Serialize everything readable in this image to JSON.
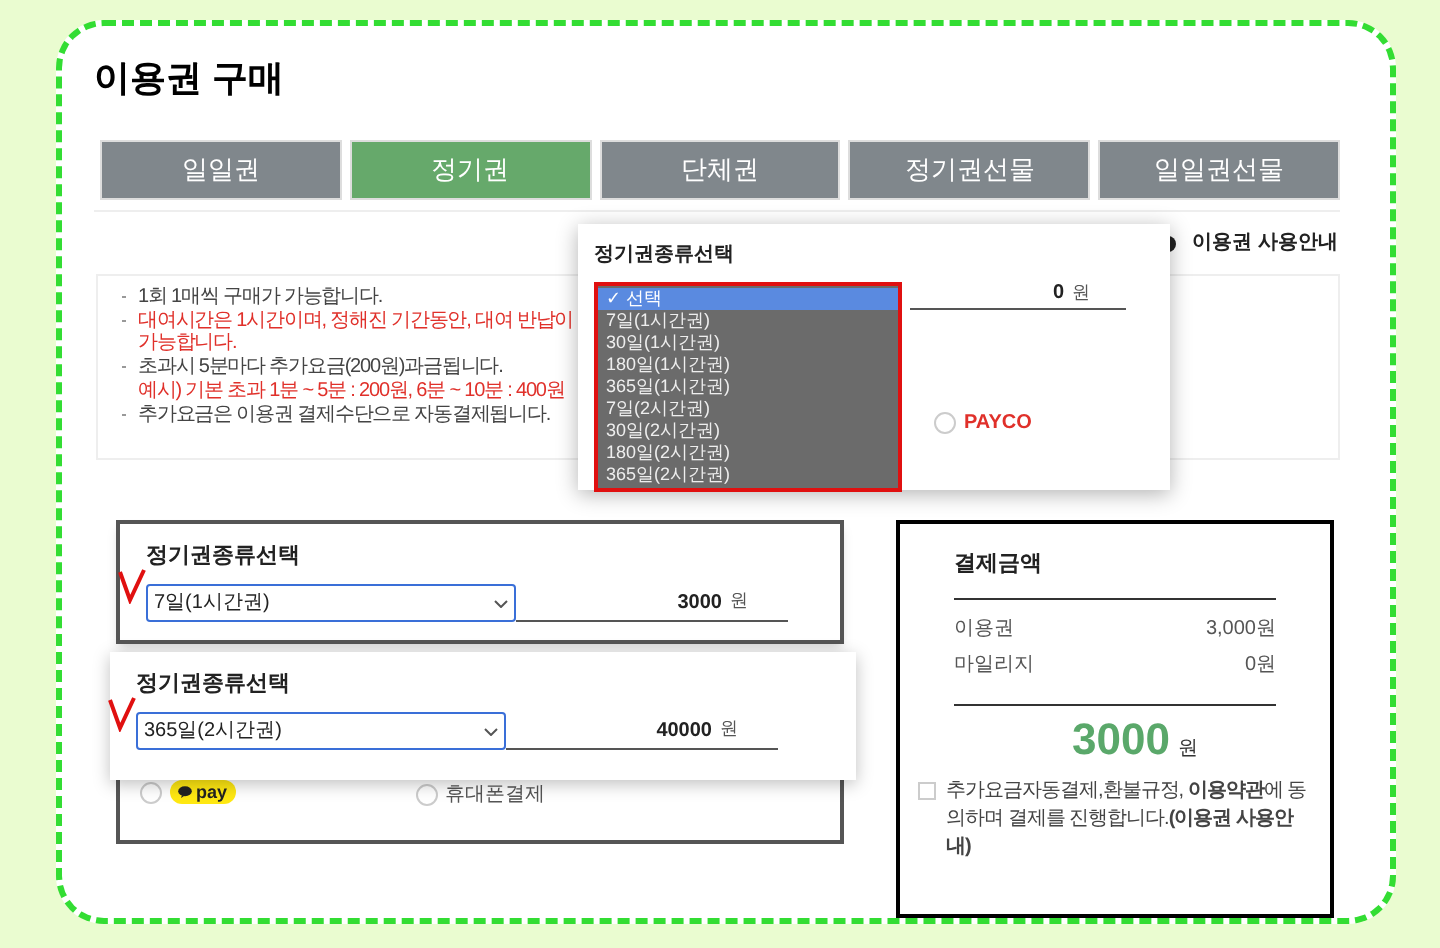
{
  "page_title": "이용권 구매",
  "tabs": [
    {
      "label": "일일권",
      "selected": false
    },
    {
      "label": "정기권",
      "selected": true
    },
    {
      "label": "단체권",
      "selected": false
    },
    {
      "label": "정기권선물",
      "selected": false
    },
    {
      "label": "일일권선물",
      "selected": false
    }
  ],
  "usage_guide_link": "이용권 사용안내",
  "notices": [
    {
      "kind": "bullet",
      "text": "1회 1매씩 구매가 가능합니다."
    },
    {
      "kind": "warning",
      "text": "대여시간은 1시간이며, 정해진 기간동안, 대여 반납이 가능합니다."
    },
    {
      "kind": "bullet",
      "text": "초과시 5분마다 추가요금(200원)과금됩니다."
    },
    {
      "kind": "example",
      "text": "예시) 기본 초과 1분 ~ 5분 : 200원, 6분 ~ 10분 : 400원"
    },
    {
      "kind": "bullet",
      "text": "추가요금은 이용권 결제수단으로 자동결제됩니다."
    }
  ],
  "background_payment_option": {
    "label": "PAYCO",
    "selected": false
  },
  "pass_select_popup": {
    "title": "정기권종류선택",
    "amount": "0",
    "unit": "원",
    "selected_marker": "✓",
    "options": [
      {
        "label": "선택",
        "selected": true
      },
      {
        "label": "7일(1시간권)",
        "selected": false
      },
      {
        "label": "30일(1시간권)",
        "selected": false
      },
      {
        "label": "180일(1시간권)",
        "selected": false
      },
      {
        "label": "365일(1시간권)",
        "selected": false
      },
      {
        "label": "7일(2시간권)",
        "selected": false
      },
      {
        "label": "30일(2시간권)",
        "selected": false
      },
      {
        "label": "180일(2시간권)",
        "selected": false
      },
      {
        "label": "365일(2시간권)",
        "selected": false
      }
    ]
  },
  "pass_cards": [
    {
      "title": "정기권종류선택",
      "value": "7일(1시간권)",
      "amount": "3000",
      "unit": "원"
    },
    {
      "title": "정기권종류선택",
      "value": "365일(2시간권)",
      "amount": "40000",
      "unit": "원"
    }
  ],
  "payment_methods": [
    {
      "kind": "kakaopay",
      "label": "pay",
      "selected": false
    },
    {
      "kind": "phone",
      "label": "휴대폰결제",
      "selected": false
    }
  ],
  "summary": {
    "title": "결제금액",
    "rows": [
      {
        "label": "이용권",
        "value": "3,000원"
      },
      {
        "label": "마일리지",
        "value": "0원"
      }
    ],
    "total": "3000",
    "unit": "원",
    "agreement": {
      "text": "추가요금자동결제,환불규정, **이용약관**에 동의하며 결제를 진행합니다.**(이용권 사용안내)**",
      "checked": false
    }
  }
}
